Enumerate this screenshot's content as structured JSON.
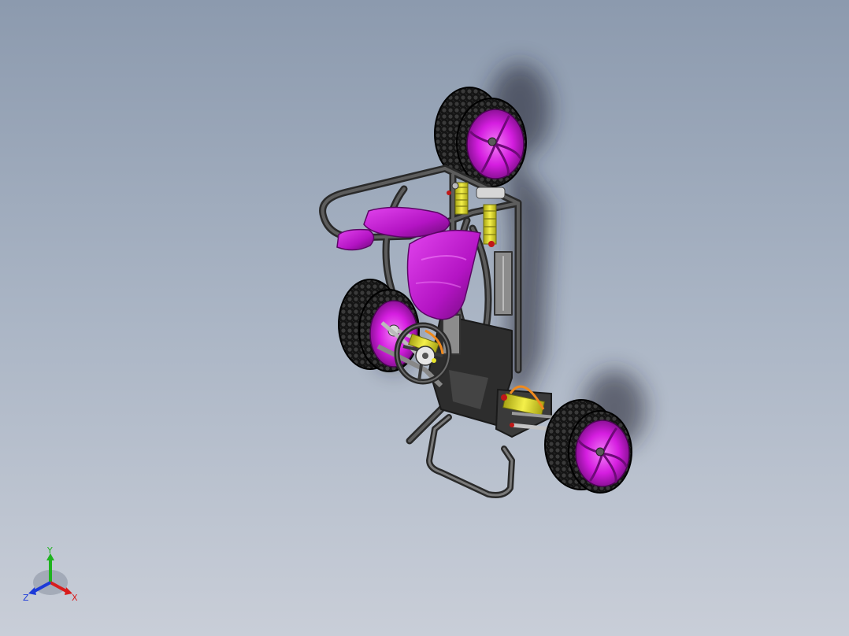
{
  "viewport": {
    "background_top": "#8c9aae",
    "background_bottom": "#c9ced8"
  },
  "model": {
    "rim_color": "#d51ee0",
    "tire_color": "#1f1f1f",
    "frame_color": "#3c3c3c",
    "seat_color": "#c21bd0",
    "spring_color": "#e8e42a",
    "accent_orange": "#f08a1e"
  },
  "triad": {
    "x_label": "X",
    "y_label": "Y",
    "z_label": "Z",
    "x_color": "#d81c1c",
    "y_color": "#1fb31f",
    "z_color": "#1c3ad8"
  }
}
